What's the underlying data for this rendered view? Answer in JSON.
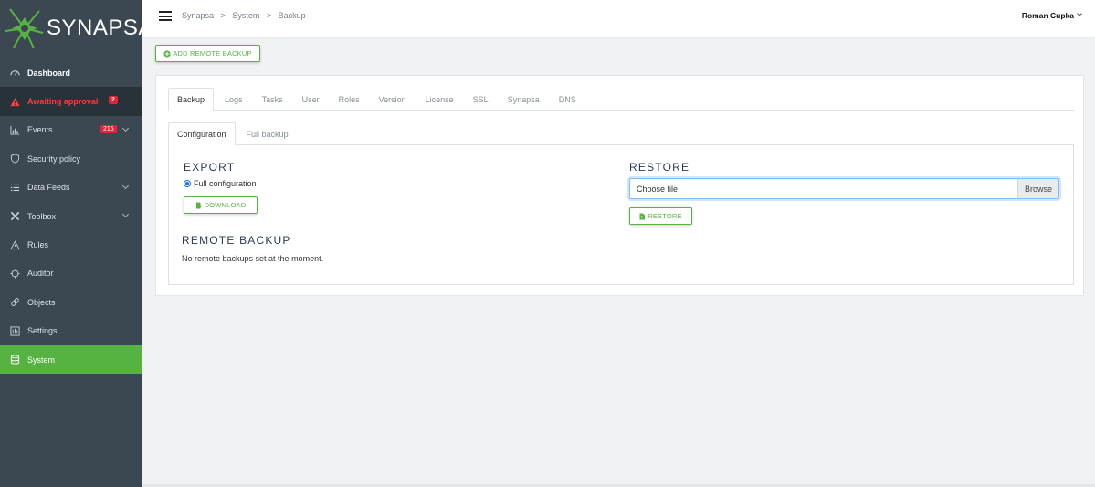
{
  "app": {
    "logo_text": "SYNAPSA"
  },
  "sidebar": {
    "items": [
      {
        "label": "Dashboard",
        "icon": "dashboard-icon"
      },
      {
        "label": "Awaiting approval",
        "icon": "warning-icon",
        "badge": "2"
      },
      {
        "label": "Events",
        "icon": "bar-chart-icon",
        "badge": "216"
      },
      {
        "label": "Security policy",
        "icon": "shield-icon"
      },
      {
        "label": "Data Feeds",
        "icon": "list-icon"
      },
      {
        "label": "Toolbox",
        "icon": "tools-icon"
      },
      {
        "label": "Rules",
        "icon": "alert-triangle-icon"
      },
      {
        "label": "Auditor",
        "icon": "crosshair-icon"
      },
      {
        "label": "Objects",
        "icon": "link-icon"
      },
      {
        "label": "Settings",
        "icon": "settings-icon"
      },
      {
        "label": "System",
        "icon": "database-icon"
      }
    ]
  },
  "header": {
    "breadcrumb": [
      "Synapsa",
      "System",
      "Backup"
    ],
    "breadcrumb_sep": ">",
    "user": "Roman Cupka"
  },
  "toolbar": {
    "add_remote_backup": "ADD REMOTE BACKUP"
  },
  "tabs": [
    "Backup",
    "Logs",
    "Tasks",
    "User",
    "Roles",
    "Version",
    "License",
    "SSL",
    "Synapsa",
    "DNS"
  ],
  "subtabs": [
    "Configuration",
    "Full backup"
  ],
  "export": {
    "heading": "EXPORT",
    "option_label": "Full configuration",
    "download_label": "DOWNLOAD"
  },
  "restore": {
    "heading": "RESTORE",
    "file_placeholder": "Choose file",
    "browse_label": "Browse",
    "restore_label": "RESTORE"
  },
  "remote_backup": {
    "heading": "REMOTE BACKUP",
    "empty_text": "No remote backups set at the moment."
  },
  "colors": {
    "sidebar_bg": "#3b4852",
    "accent_green": "#56b341",
    "alert_red": "#e8213a",
    "heading_navy": "#2c3a55"
  }
}
